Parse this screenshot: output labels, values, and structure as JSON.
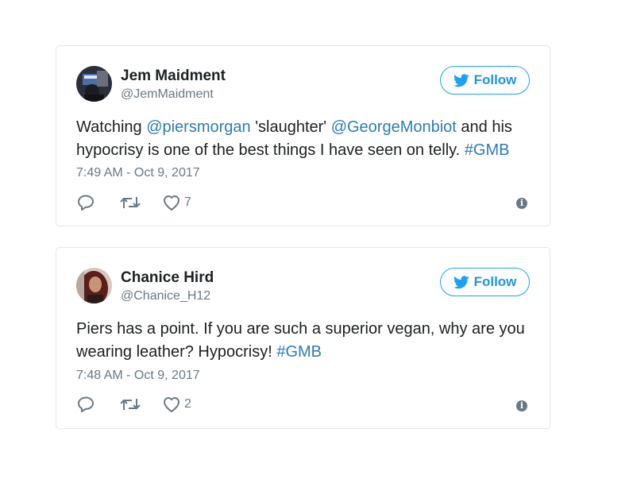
{
  "follow_label": "Follow",
  "tweets": [
    {
      "name": "Jem Maidment",
      "handle": "@JemMaidment",
      "text_parts": [
        {
          "t": "Watching ",
          "link": false
        },
        {
          "t": "@piersmorgan",
          "link": true
        },
        {
          "t": " 'slaughter' ",
          "link": false
        },
        {
          "t": "@GeorgeMonbiot",
          "link": true
        },
        {
          "t": " and his hypocrisy is one of the best things I have seen on telly. ",
          "link": false
        },
        {
          "t": "#GMB",
          "link": true
        }
      ],
      "timestamp": "7:49 AM - Oct 9, 2017",
      "likes": "7"
    },
    {
      "name": "Chanice Hird",
      "handle": "@Chanice_H12",
      "text_parts": [
        {
          "t": "Piers has a point. If you are such a superior vegan, why are you wearing leather? Hypocrisy! ",
          "link": false
        },
        {
          "t": "#GMB",
          "link": true
        }
      ],
      "timestamp": "7:48 AM - Oct 9, 2017",
      "likes": "2"
    }
  ],
  "colors": {
    "text": "#1c2022",
    "secondary": "#697882",
    "link": "#2b7bb9",
    "brand": "#1da1f2",
    "border": "#e1e8ed"
  },
  "icons": [
    "avatar",
    "twitter-bird-icon",
    "reply-icon",
    "retweet-icon",
    "heart-icon",
    "info-icon"
  ]
}
